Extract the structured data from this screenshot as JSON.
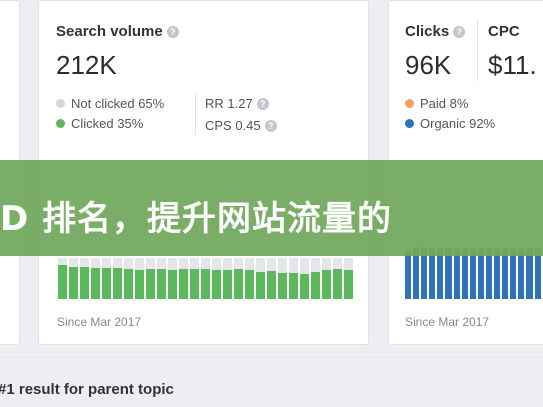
{
  "search_volume": {
    "label": "Search volume",
    "value": "212K",
    "legend": [
      {
        "label": "Not clicked 65%",
        "color": "#d4d6da"
      },
      {
        "label": "Clicked 35%",
        "color": "#5cb85c"
      }
    ],
    "rr": "RR 1.27",
    "cps": "CPS 0.45",
    "since": "Since Mar 2017",
    "bar_color": "#5cb85c",
    "bar_track_color": "#e4e6ea",
    "bars": [
      0.82,
      0.78,
      0.77,
      0.76,
      0.75,
      0.76,
      0.72,
      0.7,
      0.74,
      0.73,
      0.71,
      0.72,
      0.73,
      0.72,
      0.71,
      0.7,
      0.72,
      0.7,
      0.66,
      0.68,
      0.64,
      0.64,
      0.62,
      0.66,
      0.71,
      0.73,
      0.71
    ]
  },
  "clicks": {
    "label": "Clicks",
    "value": "96K",
    "cpc_label": "CPC",
    "cpc_value": "$11.",
    "legend": [
      {
        "label": "Paid 8%",
        "color": "#f0a35e"
      },
      {
        "label": "Organic 92%",
        "color": "#2f73b5"
      }
    ],
    "since": "Since Mar 2017",
    "bar_color": "#2f73b5",
    "bar_paid_color": "#f0a35e",
    "bars": [
      0.95,
      1.0,
      0.98,
      0.96,
      0.97,
      0.99,
      0.97,
      0.98,
      0.96,
      0.99,
      0.98,
      0.97,
      0.99,
      0.97,
      0.96,
      0.98,
      0.99,
      0.97,
      0.95,
      0.98
    ]
  },
  "banner": {
    "text": "D 排名，提升网站流量的",
    "color": "#70a85c"
  },
  "bottom": {
    "text": "#1 result for parent topic"
  }
}
